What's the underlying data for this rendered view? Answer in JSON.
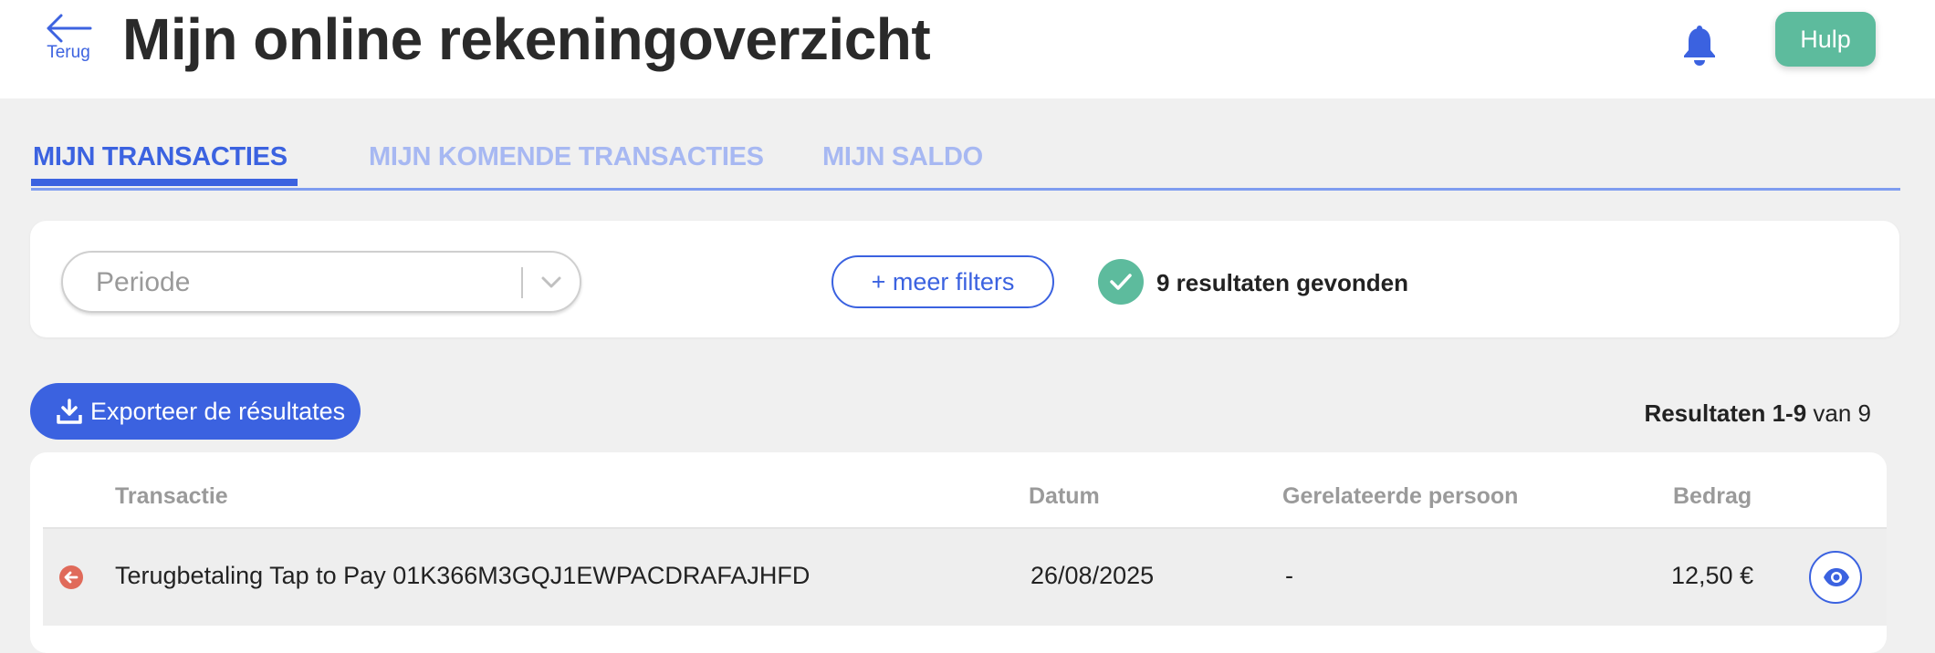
{
  "header": {
    "back_label": "Terug",
    "title": "Mijn online rekeningoverzicht",
    "help_label": "Hulp",
    "notification_icon": "bell-icon"
  },
  "tabs": [
    {
      "label": "MIJN TRANSACTIES",
      "active": true
    },
    {
      "label": "MIJN KOMENDE TRANSACTIES",
      "active": false
    },
    {
      "label": "MIJN SALDO",
      "active": false
    }
  ],
  "filters": {
    "period_placeholder": "Periode",
    "more_filters_label": "+ meer filters",
    "results_found": "9 resultaten gevonden"
  },
  "toolbar": {
    "export_label": "Exporteer de résultates",
    "pagination_bold": "Resultaten 1-9",
    "pagination_rest": " van 9"
  },
  "table": {
    "columns": {
      "transaction": "Transactie",
      "date": "Datum",
      "related_person": "Gerelateerde persoon",
      "amount": "Bedrag"
    },
    "rows": [
      {
        "transaction": "Terugbetaling Tap to Pay 01K366M3GQJ1EWPACDRAFAJHFD",
        "date": "26/08/2025",
        "related_person": "-",
        "amount": "12,50 €",
        "direction_icon": "refund-arrow-icon"
      }
    ]
  },
  "colors": {
    "primary": "#3b62e0",
    "tab_inactive": "#a7b8f2",
    "help_green": "#5dbb9d",
    "success_green": "#5dbb9d",
    "refund_red": "#e06a5a"
  }
}
